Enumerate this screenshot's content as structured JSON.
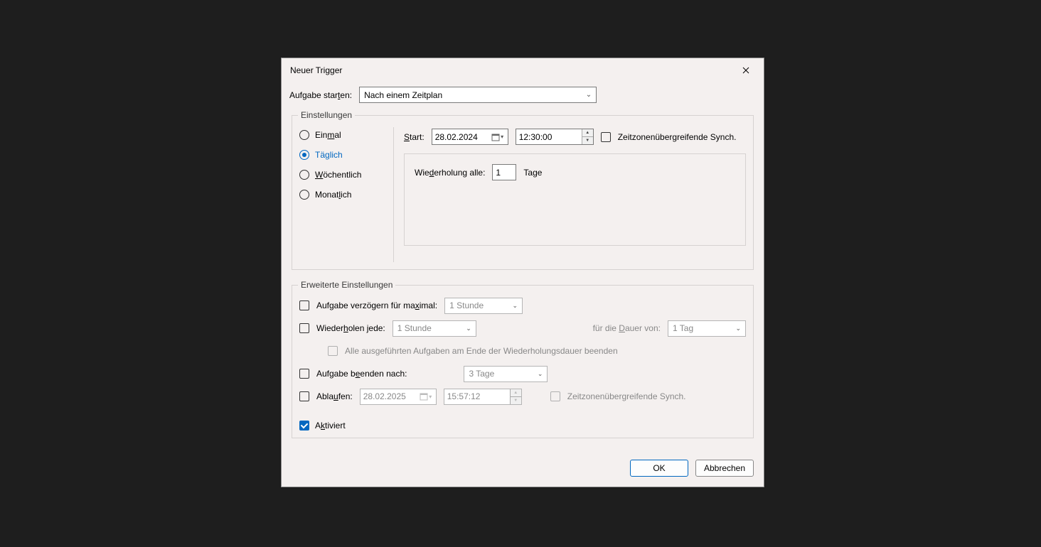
{
  "title": "Neuer Trigger",
  "task_start": {
    "label": "Aufgabe starten:",
    "selected": "Nach einem Zeitplan"
  },
  "settings": {
    "legend": "Einstellungen",
    "frequency": {
      "once": "Einmal",
      "daily": "Täglich",
      "weekly": "Wöchentlich",
      "monthly": "Monatlich",
      "selected": "daily"
    },
    "start": {
      "label": "Start:",
      "date": "28.02.2024",
      "time": "12:30:00",
      "tz_sync_label": "Zeitzonenübergreifende Synch."
    },
    "recur": {
      "label": "Wiederholung alle:",
      "value": "1",
      "unit": "Tage"
    }
  },
  "advanced": {
    "legend": "Erweiterte Einstellungen",
    "delay": {
      "label": "Aufgabe verzögern für maximal:",
      "value": "1 Stunde"
    },
    "repeat": {
      "label": "Wiederholen jede:",
      "interval": "1 Stunde",
      "duration_label": "für die Dauer von:",
      "duration": "1 Tag",
      "stop_label": "Alle ausgeführten Aufgaben am Ende der Wiederholungsdauer beenden"
    },
    "stop_after": {
      "label": "Aufgabe beenden nach:",
      "value": "3 Tage"
    },
    "expire": {
      "label": "Ablaufen:",
      "date": "28.02.2025",
      "time": "15:57:12",
      "tz_sync_label": "Zeitzonenübergreifende Synch."
    },
    "enabled_label": "Aktiviert"
  },
  "buttons": {
    "ok": "OK",
    "cancel": "Abbrechen"
  }
}
